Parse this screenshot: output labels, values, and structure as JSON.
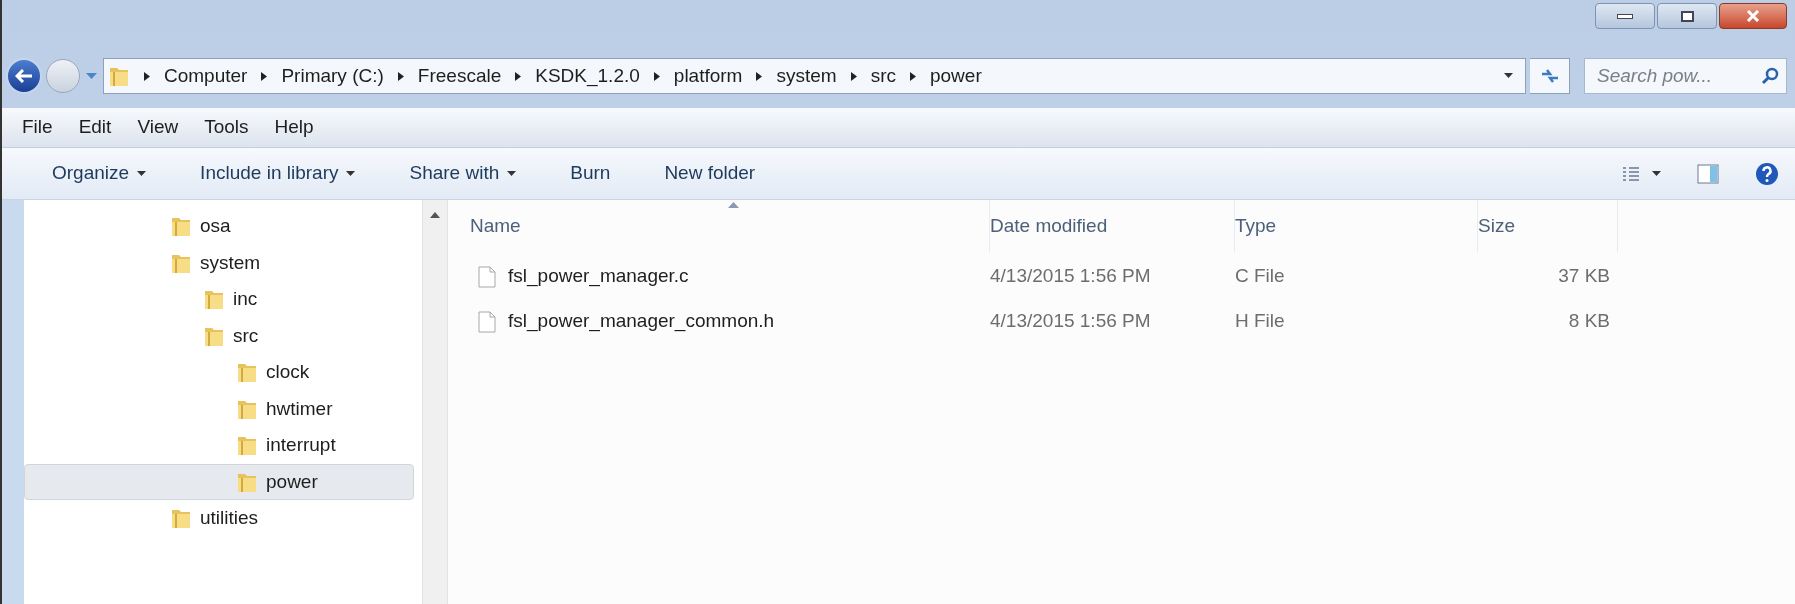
{
  "address_bar": {
    "segments": [
      "Computer",
      "Primary (C:)",
      "Freescale",
      "KSDK_1.2.0",
      "platform",
      "system",
      "src",
      "power"
    ]
  },
  "search": {
    "placeholder": "Search pow..."
  },
  "menu": [
    "File",
    "Edit",
    "View",
    "Tools",
    "Help"
  ],
  "toolbar": [
    {
      "label": "Organize",
      "dropdown": true
    },
    {
      "label": "Include in library",
      "dropdown": true
    },
    {
      "label": "Share with",
      "dropdown": true
    },
    {
      "label": "Burn",
      "dropdown": false
    },
    {
      "label": "New folder",
      "dropdown": false
    }
  ],
  "sidebar": {
    "items": [
      {
        "label": "osa",
        "selected": false
      },
      {
        "label": "system",
        "selected": false,
        "children": [
          {
            "label": "inc",
            "selected": false
          },
          {
            "label": "src",
            "selected": false,
            "children": [
              {
                "label": "clock",
                "selected": false
              },
              {
                "label": "hwtimer",
                "selected": false
              },
              {
                "label": "interrupt",
                "selected": false
              },
              {
                "label": "power",
                "selected": true
              }
            ]
          }
        ]
      },
      {
        "label": "utilities",
        "selected": false
      }
    ]
  },
  "table": {
    "columns": [
      "Name",
      "Date modified",
      "Type",
      "Size"
    ],
    "rows": [
      {
        "name": "fsl_power_manager.c",
        "date": "4/13/2015 1:56 PM",
        "type": "C File",
        "size": "37 KB"
      },
      {
        "name": "fsl_power_manager_common.h",
        "date": "4/13/2015 1:56 PM",
        "type": "H File",
        "size": "8 KB"
      }
    ]
  }
}
